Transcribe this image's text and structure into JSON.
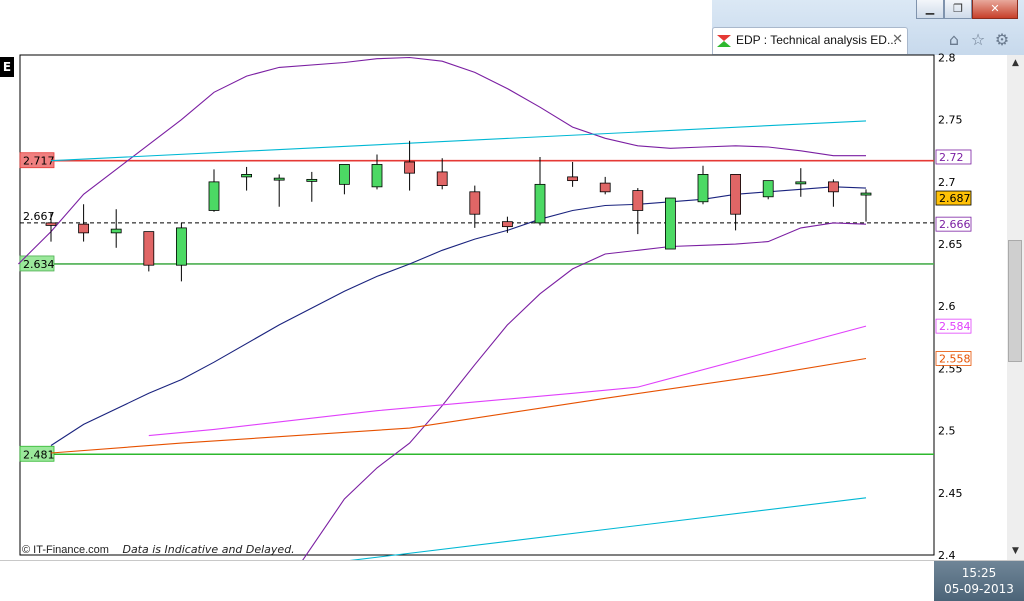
{
  "window": {
    "tab_title": "EDP : Technical analysis ED...",
    "tab_close": "✕",
    "min_glyph": "▁",
    "max_glyph": "❐",
    "close_glyph": "✕",
    "left_tab_label": "E",
    "icons": [
      "home-icon",
      "star-icon",
      "gear-icon"
    ]
  },
  "footer": {
    "source": "© IT-Finance.com",
    "disclaimer": "Data is Indicative and Delayed."
  },
  "taskbar": {
    "time": "15:25",
    "date": "05-09-2013"
  },
  "chart_data": {
    "type": "candlestick",
    "ylim": [
      2.4,
      2.8
    ],
    "yticks": [
      "2.8",
      "2.75",
      "2.7",
      "2.65",
      "2.6",
      "2.55",
      "2.5",
      "2.45",
      "2.4"
    ],
    "ytick_values": [
      2.8,
      2.75,
      2.7,
      2.65,
      2.6,
      2.55,
      2.5,
      2.45,
      2.4
    ],
    "x_range": [
      0,
      31
    ],
    "grid": false,
    "candles": [
      {
        "x": 1,
        "o": 2.667,
        "h": 2.675,
        "l": 2.652,
        "c": 2.665
      },
      {
        "x": 2,
        "o": 2.666,
        "h": 2.682,
        "l": 2.652,
        "c": 2.659
      },
      {
        "x": 3,
        "o": 2.659,
        "h": 2.678,
        "l": 2.647,
        "c": 2.662
      },
      {
        "x": 4,
        "o": 2.66,
        "h": 2.66,
        "l": 2.628,
        "c": 2.633
      },
      {
        "x": 5,
        "o": 2.633,
        "h": 2.667,
        "l": 2.62,
        "c": 2.663
      },
      {
        "x": 6,
        "o": 2.677,
        "h": 2.71,
        "l": 2.676,
        "c": 2.7
      },
      {
        "x": 7,
        "o": 2.704,
        "h": 2.712,
        "l": 2.693,
        "c": 2.706
      },
      {
        "x": 8,
        "o": 2.703,
        "h": 2.706,
        "l": 2.68,
        "c": 2.703
      },
      {
        "x": 9,
        "o": 2.701,
        "h": 2.708,
        "l": 2.684,
        "c": 2.702
      },
      {
        "x": 10,
        "o": 2.698,
        "h": 2.712,
        "l": 2.69,
        "c": 2.714
      },
      {
        "x": 11,
        "o": 2.696,
        "h": 2.722,
        "l": 2.694,
        "c": 2.714
      },
      {
        "x": 12,
        "o": 2.716,
        "h": 2.733,
        "l": 2.693,
        "c": 2.707
      },
      {
        "x": 13,
        "o": 2.708,
        "h": 2.719,
        "l": 2.694,
        "c": 2.697
      },
      {
        "x": 14,
        "o": 2.692,
        "h": 2.697,
        "l": 2.663,
        "c": 2.674
      },
      {
        "x": 15,
        "o": 2.668,
        "h": 2.672,
        "l": 2.659,
        "c": 2.664
      },
      {
        "x": 16,
        "o": 2.667,
        "h": 2.72,
        "l": 2.665,
        "c": 2.698
      },
      {
        "x": 17,
        "o": 2.704,
        "h": 2.716,
        "l": 2.696,
        "c": 2.701
      },
      {
        "x": 18,
        "o": 2.699,
        "h": 2.704,
        "l": 2.69,
        "c": 2.692
      },
      {
        "x": 19,
        "o": 2.693,
        "h": 2.695,
        "l": 2.658,
        "c": 2.677
      },
      {
        "x": 20,
        "o": 2.646,
        "h": 2.687,
        "l": 2.646,
        "c": 2.687
      },
      {
        "x": 21,
        "o": 2.684,
        "h": 2.713,
        "l": 2.682,
        "c": 2.706
      },
      {
        "x": 22,
        "o": 2.706,
        "h": 2.706,
        "l": 2.661,
        "c": 2.674
      },
      {
        "x": 23,
        "o": 2.688,
        "h": 2.701,
        "l": 2.686,
        "c": 2.701
      },
      {
        "x": 24,
        "o": 2.7,
        "h": 2.711,
        "l": 2.688,
        "c": 2.7
      },
      {
        "x": 25,
        "o": 2.7,
        "h": 2.702,
        "l": 2.68,
        "c": 2.692
      },
      {
        "x": 26,
        "o": 2.691,
        "h": 2.694,
        "l": 2.668,
        "c": 2.691
      }
    ],
    "series": [
      {
        "color": "#7b1fa2",
        "points": [
          [
            0,
            2.634
          ],
          [
            1,
            2.66
          ],
          [
            2,
            2.69
          ],
          [
            4,
            2.73
          ],
          [
            5,
            2.75
          ],
          [
            6,
            2.772
          ],
          [
            7,
            2.785
          ],
          [
            8,
            2.792
          ],
          [
            10,
            2.796
          ],
          [
            11,
            2.799
          ],
          [
            12,
            2.8
          ],
          [
            13,
            2.797
          ],
          [
            14,
            2.788
          ],
          [
            15,
            2.775
          ],
          [
            16,
            2.76
          ],
          [
            17,
            2.744
          ],
          [
            18,
            2.735
          ],
          [
            19,
            2.729
          ],
          [
            20,
            2.727
          ],
          [
            21,
            2.728
          ],
          [
            22,
            2.729
          ],
          [
            23,
            2.728
          ],
          [
            24,
            2.725
          ],
          [
            25,
            2.721
          ],
          [
            26,
            2.721
          ]
        ]
      },
      {
        "color": "#7b1fa2",
        "points": [
          [
            8.7,
            2.395
          ],
          [
            10,
            2.445
          ],
          [
            11,
            2.47
          ],
          [
            12,
            2.49
          ],
          [
            13,
            2.52
          ],
          [
            14,
            2.553
          ],
          [
            15,
            2.585
          ],
          [
            16,
            2.61
          ],
          [
            17,
            2.63
          ],
          [
            18,
            2.642
          ],
          [
            19,
            2.645
          ],
          [
            20,
            2.648
          ],
          [
            21,
            2.649
          ],
          [
            22,
            2.65
          ],
          [
            23,
            2.652
          ],
          [
            24,
            2.663
          ],
          [
            25,
            2.667
          ],
          [
            26,
            2.666
          ]
        ]
      },
      {
        "color": "#1a237e",
        "points": [
          [
            1,
            2.488
          ],
          [
            2,
            2.505
          ],
          [
            4,
            2.53
          ],
          [
            5,
            2.541
          ],
          [
            6,
            2.555
          ],
          [
            8,
            2.585
          ],
          [
            10,
            2.612
          ],
          [
            11,
            2.624
          ],
          [
            12,
            2.634
          ],
          [
            13,
            2.645
          ],
          [
            14,
            2.654
          ],
          [
            15,
            2.661
          ],
          [
            16,
            2.67
          ],
          [
            17,
            2.677
          ],
          [
            18,
            2.681
          ],
          [
            19,
            2.682
          ],
          [
            20,
            2.684
          ],
          [
            21,
            2.686
          ],
          [
            22,
            2.69
          ],
          [
            23,
            2.692
          ],
          [
            24,
            2.694
          ],
          [
            25,
            2.696
          ],
          [
            26,
            2.695
          ]
        ]
      },
      {
        "color": "#00b8d4",
        "points": [
          [
            1,
            2.717
          ],
          [
            26,
            2.749
          ]
        ]
      },
      {
        "color": "#00b8d4",
        "points": [
          [
            10,
            2.395
          ],
          [
            26,
            2.446
          ]
        ]
      },
      {
        "color": "#e040fb",
        "points": [
          [
            4,
            2.496
          ],
          [
            6,
            2.501
          ],
          [
            11,
            2.516
          ],
          [
            17,
            2.53
          ],
          [
            19,
            2.535
          ],
          [
            26,
            2.584
          ]
        ]
      },
      {
        "color": "#e65100",
        "points": [
          [
            1,
            2.482
          ],
          [
            5,
            2.49
          ],
          [
            12,
            2.502
          ],
          [
            18,
            2.526
          ],
          [
            23,
            2.545
          ],
          [
            26,
            2.558
          ]
        ]
      }
    ],
    "hlines": [
      {
        "y": 2.717,
        "color": "#e53935",
        "label": "2.717",
        "label_bg": "#f08080",
        "style": "solid"
      },
      {
        "y": 2.634,
        "color": "#4caf50",
        "label": "2.634",
        "label_bg": "#9be89b",
        "style": "solid"
      },
      {
        "y": 2.481,
        "color": "#2eb82e",
        "label": "2.481",
        "label_bg": "#9be89b",
        "style": "solid"
      },
      {
        "y": 2.667,
        "color": "#000000",
        "label": "2.667",
        "label_bg": "",
        "style": "dashed"
      }
    ],
    "right_labels": [
      {
        "y": 2.72,
        "text": "2.72",
        "color": "#7b1fa2",
        "bg": "#ffffff"
      },
      {
        "y": 2.687,
        "text": "2.687",
        "color": "#000000",
        "bg": "#ffc107"
      },
      {
        "y": 2.666,
        "text": "2.666",
        "color": "#7b1fa2",
        "bg": "#ffffff"
      },
      {
        "y": 2.584,
        "text": "2.584",
        "color": "#e040fb",
        "bg": "#ffffff"
      },
      {
        "y": 2.558,
        "text": "2.558",
        "color": "#e65100",
        "bg": "#ffffff"
      }
    ],
    "colors": {
      "up": "#4cd964",
      "down": "#e06666",
      "axis": "#000000"
    }
  }
}
